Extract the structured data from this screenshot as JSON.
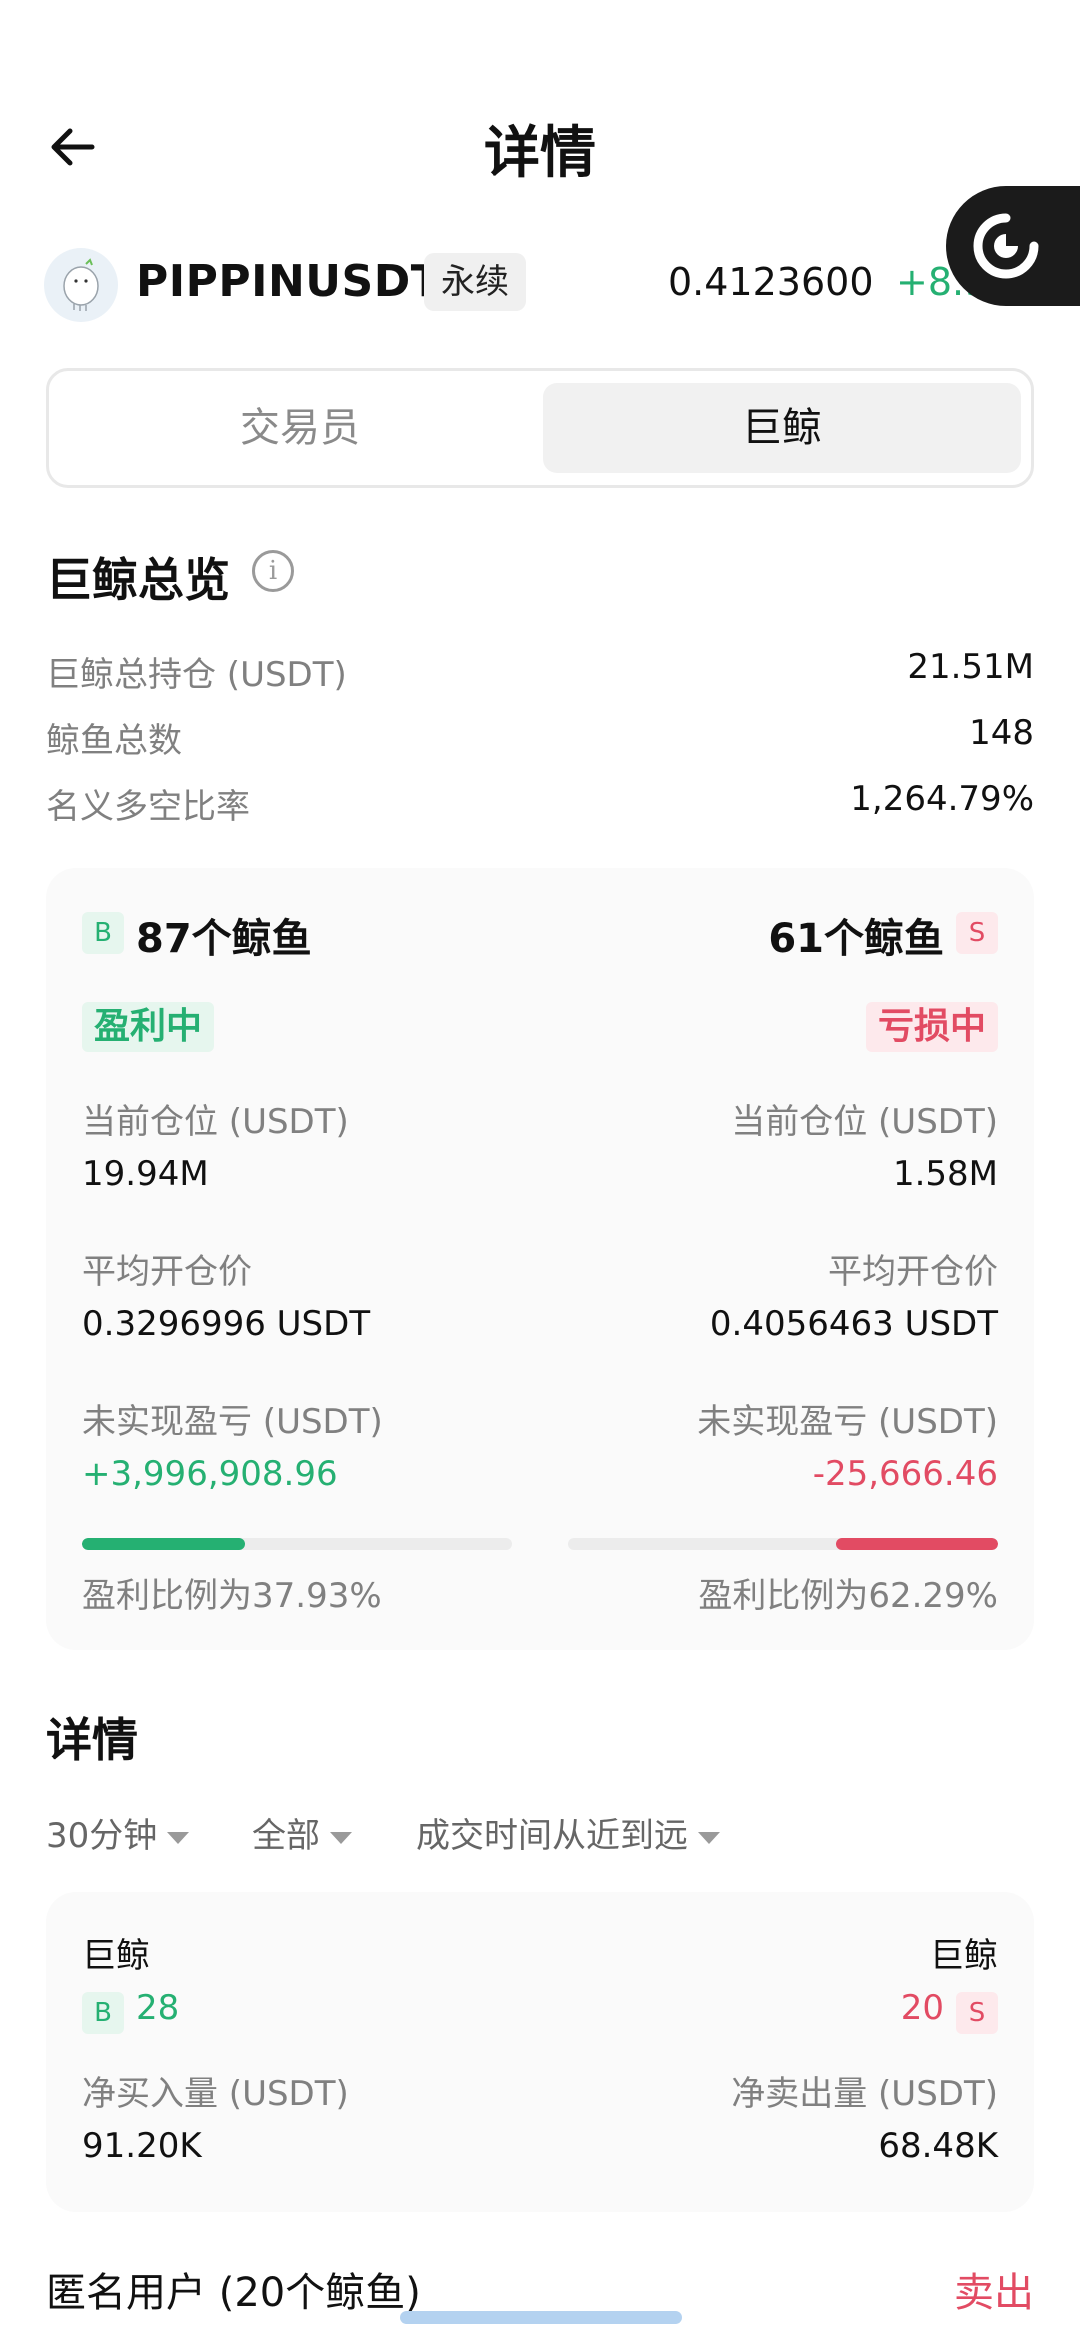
{
  "header": {
    "title": "详情"
  },
  "ticker": {
    "symbol": "PIPPINUSDT",
    "tag": "永续",
    "price": "0.4123600",
    "change": "+8.94%"
  },
  "tabs": [
    {
      "label": "交易员",
      "active": false
    },
    {
      "label": "巨鲸",
      "active": true
    }
  ],
  "overview": {
    "title": "巨鲸总览",
    "info_glyph": "i",
    "rows": [
      {
        "label": "巨鲸总持仓 (USDT)",
        "value": "21.51M"
      },
      {
        "label": "鲸鱼总数",
        "value": "148"
      },
      {
        "label": "名义多空比率",
        "value": "1,264.79%"
      }
    ]
  },
  "summary": {
    "long": {
      "badge": "B",
      "count_label": "87个鲸鱼",
      "status": "盈利中",
      "position_label": "当前仓位 (USDT)",
      "position_value": "19.94M",
      "avg_label": "平均开仓价",
      "avg_value": "0.3296996 USDT",
      "pnl_label": "未实现盈亏 (USDT)",
      "pnl_value": "+3,996,908.96",
      "ratio_label": "盈利比例为37.93%",
      "ratio_fraction": 0.3793
    },
    "short": {
      "badge": "S",
      "count_label": "61个鲸鱼",
      "status": "亏损中",
      "position_label": "当前仓位 (USDT)",
      "position_value": "1.58M",
      "avg_label": "平均开仓价",
      "avg_value": "0.4056463 USDT",
      "pnl_label": "未实现盈亏 (USDT)",
      "pnl_value": "-25,666.46",
      "ratio_label": "盈利比例为62.29%",
      "ratio_fraction": 0.6229
    }
  },
  "details": {
    "title": "详情",
    "filters": [
      {
        "label": "30分钟"
      },
      {
        "label": "全部"
      },
      {
        "label": "成交时间从近到远"
      }
    ],
    "card": {
      "left": {
        "title": "巨鲸",
        "badge": "B",
        "count": "28",
        "flow_label": "净买入量 (USDT)",
        "flow_value": "91.20K"
      },
      "right": {
        "title": "巨鲸",
        "badge": "S",
        "count": "20",
        "flow_label": "净卖出量 (USDT)",
        "flow_value": "68.48K"
      }
    },
    "row": {
      "user": "匿名用户 (20个鲸鱼)",
      "side": "卖出"
    }
  },
  "colors": {
    "green": "#25b072",
    "red": "#e24b63",
    "card_bg": "#fafafa"
  }
}
